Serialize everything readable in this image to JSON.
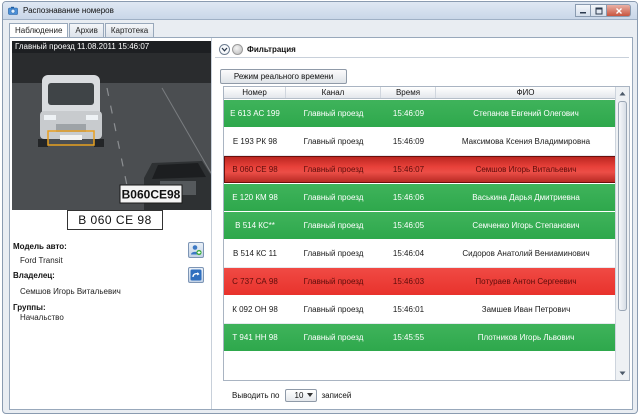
{
  "window": {
    "title": "Распознавание номеров",
    "icon": "app-camera-icon"
  },
  "tabs": [
    {
      "label": "Наблюдение",
      "active": true
    },
    {
      "label": "Архив",
      "active": false
    },
    {
      "label": "Картотека",
      "active": false
    }
  ],
  "camera": {
    "header": "Главный проезд  11.08.2011 15:46:07",
    "overlay_plate": "B060CE98",
    "colors": {
      "frame_bg": "#2a2c2e",
      "detection_box": "#e8a020"
    }
  },
  "recognized_plate": "В 060 СЕ 98",
  "vehicle": {
    "model_label": "Модель авто:",
    "model_value": "Ford Transit",
    "owner_label": "Владелец:",
    "owner_value": "Семшов Игорь Витальевич",
    "groups_label": "Группы:",
    "groups_value": "Начальство"
  },
  "side_buttons": {
    "add_icon": "add-person-icon",
    "redo_icon": "redo-arrow-icon"
  },
  "filter": {
    "label": "Фильтрация"
  },
  "realtime_button": "Режим реального времени",
  "table": {
    "headers": [
      "Номер",
      "Канал",
      "Время",
      "ФИО"
    ],
    "rows": [
      {
        "plate": "Е 613 АС 199",
        "channel": "Главный проезд",
        "time": "15:46:09",
        "name": "Степанов Евгений Олегович",
        "status": "green"
      },
      {
        "plate": "Е 193 РК 98",
        "channel": "Главный проезд",
        "time": "15:46:09",
        "name": "Максимова Ксения Владимировна",
        "status": "white"
      },
      {
        "plate": "В 060 СЕ 98",
        "channel": "Главный проезд",
        "time": "15:46:07",
        "name": "Семшов Игорь Витальевич",
        "status": "red-selected"
      },
      {
        "plate": "Е 120 КМ 98",
        "channel": "Главный проезд",
        "time": "15:46:06",
        "name": "Васькина Дарья Дмитриевна",
        "status": "green"
      },
      {
        "plate": "В 514 КС**",
        "channel": "Главный проезд",
        "time": "15:46:05",
        "name": "Семченко Игорь Степанович",
        "status": "green"
      },
      {
        "plate": "В 514 КС 11",
        "channel": "Главный проезд",
        "time": "15:46:04",
        "name": "Сидоров Анатолий Вениаминович",
        "status": "white"
      },
      {
        "plate": "С 737 СА 98",
        "channel": "Главный проезд",
        "time": "15:46:03",
        "name": "Потураев Антон Сергеевич",
        "status": "red"
      },
      {
        "plate": "К 092 ОН 98",
        "channel": "Главный проезд",
        "time": "15:46:01",
        "name": "Замшев Иван  Петрович",
        "status": "white"
      },
      {
        "plate": "Т 941 НН 98",
        "channel": "Главный проезд",
        "time": "15:45:55",
        "name": "Плотников Игорь Львович",
        "status": "green"
      }
    ]
  },
  "pager": {
    "prefix": "Выводить по",
    "value": "10",
    "suffix": "записей"
  },
  "colors": {
    "row_green": "#34ad51",
    "row_red": "#ea3a33",
    "window_frame": "#8a9bb0"
  }
}
